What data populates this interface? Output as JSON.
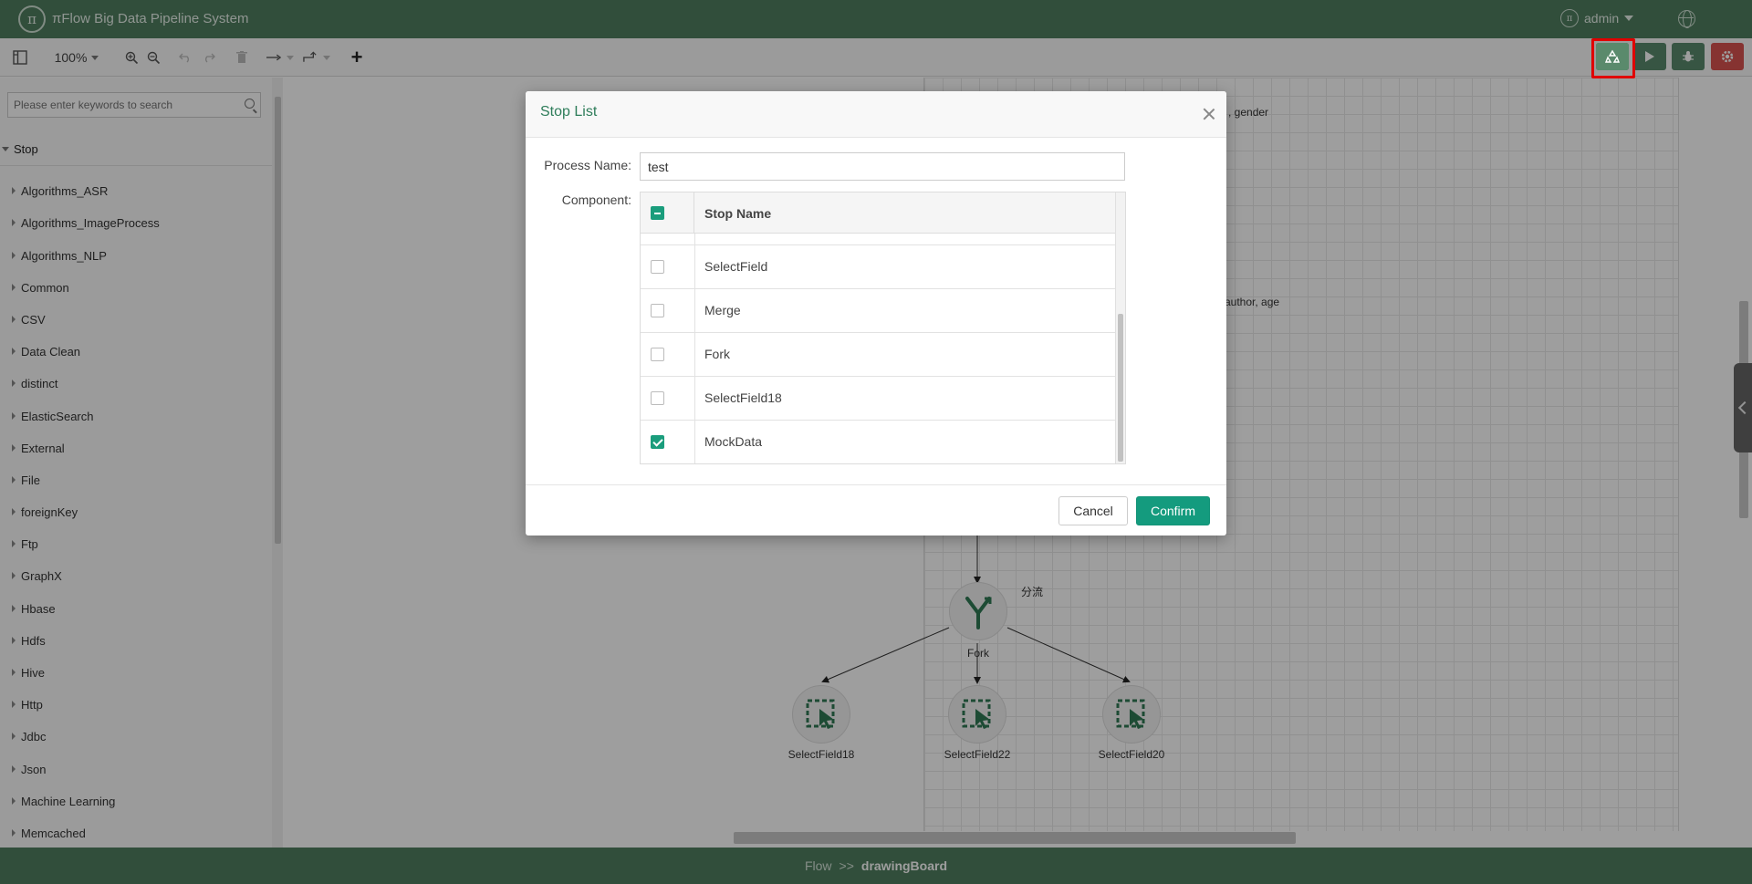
{
  "header": {
    "logo_text": "π",
    "title": "πFlow Big Data Pipeline System",
    "user_name": "admin"
  },
  "toolbar": {
    "zoom": "100%",
    "add_label": "+"
  },
  "sidebar": {
    "search_placeholder": "Please enter keywords to search",
    "root_label": "Stop",
    "items": [
      "Algorithms_ASR",
      "Algorithms_ImageProcess",
      "Algorithms_NLP",
      "Common",
      "CSV",
      "Data Clean",
      "distinct",
      "ElasticSearch",
      "External",
      "File",
      "foreignKey",
      "Ftp",
      "GraphX",
      "Hbase",
      "Hdfs",
      "Hive",
      "Http",
      "Jdbc",
      "Json",
      "Machine Learning",
      "Memcached"
    ]
  },
  "canvas": {
    "field_text_1": ", gender",
    "field_text_2": "author, age",
    "fork_note": "分流",
    "nodes": {
      "fork": "Fork",
      "select18": "SelectField18",
      "select22": "SelectField22",
      "select20": "SelectField20"
    }
  },
  "modal": {
    "title": "Stop List",
    "process_name_label": "Process Name:",
    "process_name_value": "test",
    "component_label": "Component:",
    "column_header": "Stop Name",
    "rows": [
      {
        "name": "SelectField",
        "checked": false
      },
      {
        "name": "Merge",
        "checked": false
      },
      {
        "name": "Fork",
        "checked": false
      },
      {
        "name": "SelectField18",
        "checked": false
      },
      {
        "name": "MockData",
        "checked": true
      }
    ],
    "cancel_label": "Cancel",
    "confirm_label": "Confirm"
  },
  "footer": {
    "crumb_1": "Flow",
    "separator": ">>",
    "crumb_2": "drawingBoard"
  },
  "colors": {
    "header_bg": "#4f7f5f",
    "accent": "#149b7e",
    "run_green": "#5a8a6c",
    "stop_red": "#d9534f",
    "highlight_red": "#e00000"
  }
}
